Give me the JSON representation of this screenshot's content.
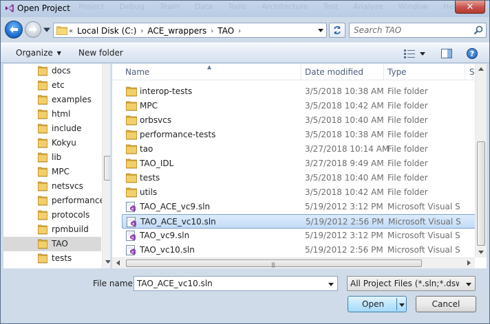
{
  "window": {
    "title": "Open Project",
    "ghost_menu": [
      "Project",
      "Debug",
      "Team",
      "Data",
      "Tools",
      "Architecture",
      "Test",
      "Analyze",
      "Window",
      "Help"
    ],
    "close_symbol": "✕"
  },
  "address": {
    "overflow": "«",
    "crumbs": [
      "Local Disk (C:)",
      "ACE_wrappers",
      "TAO"
    ],
    "separator": "›"
  },
  "search": {
    "placeholder": "Search TAO"
  },
  "toolbar": {
    "organize_label": "Organize",
    "organize_arrow": "▼",
    "new_folder_label": "New folder",
    "help_symbol": "?"
  },
  "nav": {
    "items": [
      {
        "label": "docs"
      },
      {
        "label": "etc"
      },
      {
        "label": "examples"
      },
      {
        "label": "html"
      },
      {
        "label": "include"
      },
      {
        "label": "Kokyu"
      },
      {
        "label": "lib"
      },
      {
        "label": "MPC"
      },
      {
        "label": "netsvcs"
      },
      {
        "label": "performance"
      },
      {
        "label": "protocols"
      },
      {
        "label": "rpmbuild"
      },
      {
        "label": "TAO",
        "selected": true
      },
      {
        "label": "tests"
      }
    ]
  },
  "files": {
    "columns": {
      "name": "Name",
      "date": "Date modified",
      "type": "Type",
      "size": "Si"
    },
    "sort_caret": "▲",
    "rows": [
      {
        "name": "interop-tests",
        "date": "3/5/2018 10:38 AM",
        "type": "File folder",
        "icon": "folder-icon"
      },
      {
        "name": "MPC",
        "date": "3/5/2018 10:42 AM",
        "type": "File folder",
        "icon": "folder-icon"
      },
      {
        "name": "orbsvcs",
        "date": "3/5/2018 10:40 AM",
        "type": "File folder",
        "icon": "folder-icon"
      },
      {
        "name": "performance-tests",
        "date": "3/5/2018 10:38 AM",
        "type": "File folder",
        "icon": "folder-icon"
      },
      {
        "name": "tao",
        "date": "3/27/2018 10:14 AM",
        "type": "File folder",
        "icon": "folder-icon"
      },
      {
        "name": "TAO_IDL",
        "date": "3/27/2018 9:49 AM",
        "type": "File folder",
        "icon": "folder-icon"
      },
      {
        "name": "tests",
        "date": "3/5/2018 10:40 AM",
        "type": "File folder",
        "icon": "folder-icon"
      },
      {
        "name": "utils",
        "date": "3/5/2018 10:42 AM",
        "type": "File folder",
        "icon": "folder-icon"
      },
      {
        "name": "TAO_ACE_vc9.sln",
        "date": "5/19/2012 3:12 PM",
        "type": "Microsoft Visual S...",
        "icon": "vs-solution-icon"
      },
      {
        "name": "TAO_ACE_vc10.sln",
        "date": "5/19/2012 2:56 PM",
        "type": "Microsoft Visual S...",
        "icon": "vs-solution-icon",
        "selected": true
      },
      {
        "name": "TAO_vc9.sln",
        "date": "5/19/2012 3:12 PM",
        "type": "Microsoft Visual S...",
        "icon": "vs-solution-icon"
      },
      {
        "name": "TAO_vc10.sln",
        "date": "5/19/2012 2:56 PM",
        "type": "Microsoft Visual S...",
        "icon": "vs-solution-icon"
      }
    ]
  },
  "bottom": {
    "file_name_label": "File name:",
    "file_name_value": "TAO_ACE_vc10.sln",
    "file_type_value": "All Project Files (*.sln;*.dsw;*.vc",
    "open_label": "Open",
    "cancel_label": "Cancel"
  },
  "colors": {
    "selection": "#cce4fa",
    "nav_selected": "#d9d9d9",
    "folder": "#e8c35a",
    "accent": "#1667c9"
  }
}
